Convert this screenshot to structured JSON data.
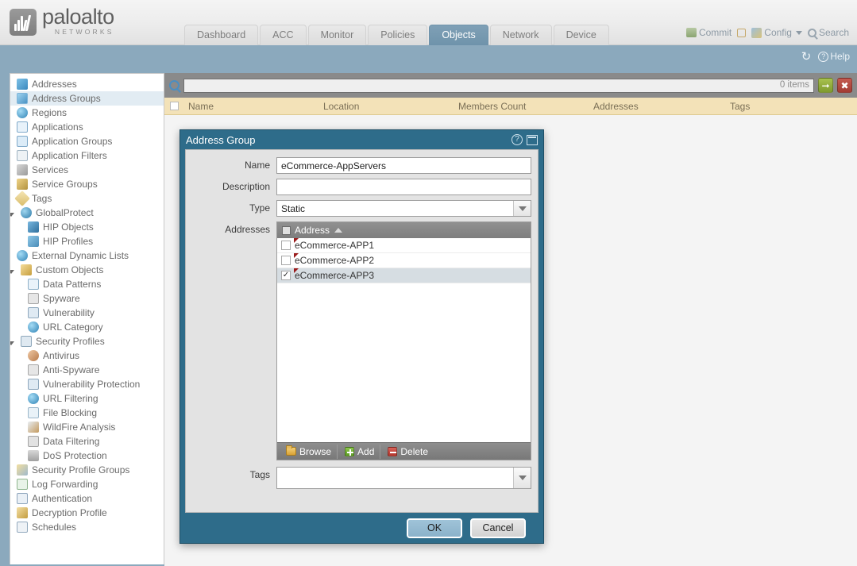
{
  "header": {
    "brand_word": "paloalto",
    "brand_sub": "NETWORKS",
    "tabs": [
      {
        "label": "Dashboard",
        "active": false
      },
      {
        "label": "ACC",
        "active": false
      },
      {
        "label": "Monitor",
        "active": false
      },
      {
        "label": "Policies",
        "active": false
      },
      {
        "label": "Objects",
        "active": true
      },
      {
        "label": "Network",
        "active": false
      },
      {
        "label": "Device",
        "active": false
      }
    ],
    "actions": {
      "commit": "Commit",
      "config": "Config",
      "search": "Search"
    },
    "band": {
      "refresh_icon": "refresh-icon",
      "help": "Help"
    }
  },
  "sidebar": {
    "items": [
      {
        "label": "Addresses",
        "level": 0,
        "icon": "address-icon",
        "selected": false,
        "twisty": null
      },
      {
        "label": "Address Groups",
        "level": 0,
        "icon": "address-group-icon",
        "selected": true,
        "twisty": null
      },
      {
        "label": "Regions",
        "level": 0,
        "icon": "region-icon",
        "selected": false,
        "twisty": null
      },
      {
        "label": "Applications",
        "level": 0,
        "icon": "application-icon",
        "selected": false,
        "twisty": null
      },
      {
        "label": "Application Groups",
        "level": 0,
        "icon": "application-group-icon",
        "selected": false,
        "twisty": null
      },
      {
        "label": "Application Filters",
        "level": 0,
        "icon": "application-filter-icon",
        "selected": false,
        "twisty": null
      },
      {
        "label": "Services",
        "level": 0,
        "icon": "service-icon",
        "selected": false,
        "twisty": null
      },
      {
        "label": "Service Groups",
        "level": 0,
        "icon": "service-group-icon",
        "selected": false,
        "twisty": null
      },
      {
        "label": "Tags",
        "level": 0,
        "icon": "tag-icon",
        "selected": false,
        "twisty": null
      },
      {
        "label": "GlobalProtect",
        "level": 0,
        "icon": "globalprotect-icon",
        "selected": false,
        "twisty": "open"
      },
      {
        "label": "HIP Objects",
        "level": 1,
        "icon": "hip-object-icon",
        "selected": false,
        "twisty": null
      },
      {
        "label": "HIP Profiles",
        "level": 1,
        "icon": "hip-profile-icon",
        "selected": false,
        "twisty": null
      },
      {
        "label": "External Dynamic Lists",
        "level": 0,
        "icon": "external-dynamic-list-icon",
        "selected": false,
        "twisty": null
      },
      {
        "label": "Custom Objects",
        "level": 0,
        "icon": "custom-object-icon",
        "selected": false,
        "twisty": "open"
      },
      {
        "label": "Data Patterns",
        "level": 1,
        "icon": "data-pattern-icon",
        "selected": false,
        "twisty": null
      },
      {
        "label": "Spyware",
        "level": 1,
        "icon": "spyware-icon",
        "selected": false,
        "twisty": null
      },
      {
        "label": "Vulnerability",
        "level": 1,
        "icon": "vulnerability-icon",
        "selected": false,
        "twisty": null
      },
      {
        "label": "URL Category",
        "level": 1,
        "icon": "url-category-icon",
        "selected": false,
        "twisty": null
      },
      {
        "label": "Security Profiles",
        "level": 0,
        "icon": "security-profile-icon",
        "selected": false,
        "twisty": "open"
      },
      {
        "label": "Antivirus",
        "level": 1,
        "icon": "antivirus-icon",
        "selected": false,
        "twisty": null
      },
      {
        "label": "Anti-Spyware",
        "level": 1,
        "icon": "anti-spyware-icon",
        "selected": false,
        "twisty": null
      },
      {
        "label": "Vulnerability Protection",
        "level": 1,
        "icon": "vulnerability-protection-icon",
        "selected": false,
        "twisty": null
      },
      {
        "label": "URL Filtering",
        "level": 1,
        "icon": "url-filtering-icon",
        "selected": false,
        "twisty": null
      },
      {
        "label": "File Blocking",
        "level": 1,
        "icon": "file-blocking-icon",
        "selected": false,
        "twisty": null
      },
      {
        "label": "WildFire Analysis",
        "level": 1,
        "icon": "wildfire-analysis-icon",
        "selected": false,
        "twisty": null
      },
      {
        "label": "Data Filtering",
        "level": 1,
        "icon": "data-filtering-icon",
        "selected": false,
        "twisty": null
      },
      {
        "label": "DoS Protection",
        "level": 1,
        "icon": "dos-protection-icon",
        "selected": false,
        "twisty": null
      },
      {
        "label": "Security Profile Groups",
        "level": 0,
        "icon": "security-profile-group-icon",
        "selected": false,
        "twisty": null
      },
      {
        "label": "Log Forwarding",
        "level": 0,
        "icon": "log-forwarding-icon",
        "selected": false,
        "twisty": null
      },
      {
        "label": "Authentication",
        "level": 0,
        "icon": "authentication-icon",
        "selected": false,
        "twisty": null
      },
      {
        "label": "Decryption Profile",
        "level": 0,
        "icon": "decryption-profile-icon",
        "selected": false,
        "twisty": null
      },
      {
        "label": "Schedules",
        "level": 0,
        "icon": "schedule-icon",
        "selected": false,
        "twisty": null
      }
    ]
  },
  "main": {
    "search": {
      "value": "",
      "placeholder": "",
      "items_count": "0 items",
      "go_icon": "arrow-right-icon",
      "clear_icon": "close-icon"
    },
    "grid_columns": [
      "Name",
      "Location",
      "Members Count",
      "Addresses",
      "Tags"
    ]
  },
  "dialog": {
    "title": "Address Group",
    "help_icon": "help-icon",
    "minimize_icon": "minimize-icon",
    "fields": {
      "name_label": "Name",
      "name_value": "eCommerce-AppServers",
      "description_label": "Description",
      "description_value": "",
      "type_label": "Type",
      "type_value": "Static",
      "addresses_label": "Addresses",
      "tags_label": "Tags",
      "tags_value": ""
    },
    "address_table": {
      "column_header": "Address",
      "sort": "ascending",
      "rows": [
        {
          "name": "eCommerce-APP1",
          "checked": false,
          "selected": false,
          "modified": true
        },
        {
          "name": "eCommerce-APP2",
          "checked": false,
          "selected": false,
          "modified": true
        },
        {
          "name": "eCommerce-APP3",
          "checked": true,
          "selected": true,
          "modified": true
        }
      ]
    },
    "toolbar": {
      "browse": "Browse",
      "add": "Add",
      "delete": "Delete"
    },
    "buttons": {
      "ok": "OK",
      "cancel": "Cancel"
    }
  },
  "colors": {
    "brand_blue": "#8ba9bd",
    "dialog_header": "#2e6c8a",
    "grid_header": "#f3e2b8",
    "active_tab": "#7fa0b6",
    "modified_marker": "#9b1b1b"
  }
}
